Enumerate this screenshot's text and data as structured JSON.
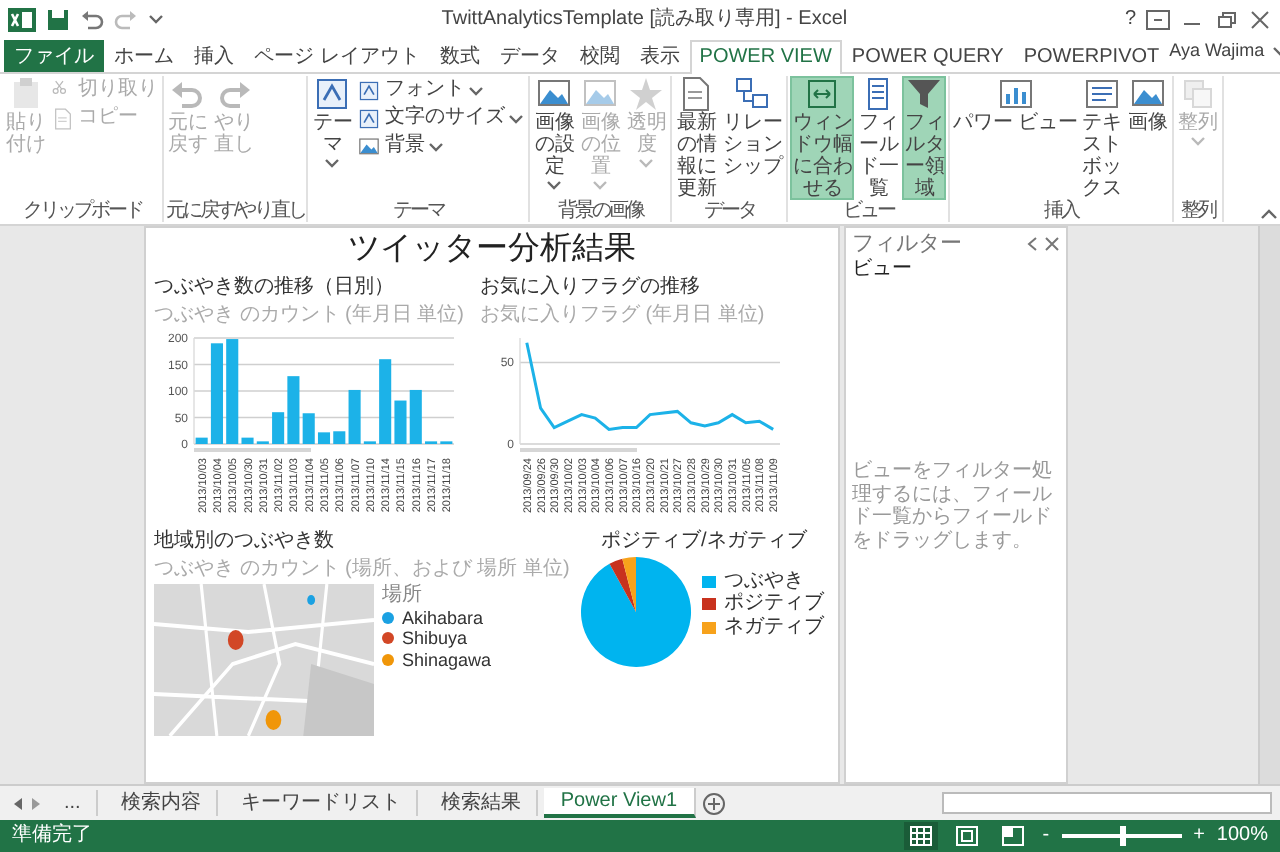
{
  "title_bar": {
    "title": "TwittAnalyticsTemplate [読み取り専用] - Excel",
    "help": "?"
  },
  "tabs": [
    {
      "label": "ファイル",
      "kind": "file",
      "selected": false
    },
    {
      "label": "ホーム",
      "kind": "tab",
      "selected": false
    },
    {
      "label": "挿入",
      "kind": "tab",
      "selected": false
    },
    {
      "label": "ページ レイアウト",
      "kind": "tab",
      "selected": false
    },
    {
      "label": "数式",
      "kind": "tab",
      "selected": false
    },
    {
      "label": "データ",
      "kind": "tab",
      "selected": false
    },
    {
      "label": "校閲",
      "kind": "tab",
      "selected": false
    },
    {
      "label": "表示",
      "kind": "tab",
      "selected": false
    },
    {
      "label": "POWER VIEW",
      "kind": "tab",
      "selected": true
    },
    {
      "label": "POWER QUERY",
      "kind": "tab",
      "selected": false
    },
    {
      "label": "POWERPIVOT",
      "kind": "tab",
      "selected": false
    }
  ],
  "account": {
    "name": "Aya Wajima"
  },
  "ribbon": {
    "groups": [
      {
        "label": "クリップボード",
        "buttons": [
          {
            "label": "貼り付け",
            "kind": "large",
            "dropdown": false,
            "disabled": true,
            "on": false
          },
          {
            "label": "切り取り",
            "kind": "small",
            "dropdown": false,
            "disabled": true,
            "on": false
          },
          {
            "label": "コピー",
            "kind": "small",
            "dropdown": false,
            "disabled": true,
            "on": false
          }
        ]
      },
      {
        "label": "元に戻す/やり直し",
        "buttons": [
          {
            "label": "元に戻す",
            "kind": "large",
            "dropdown": false,
            "disabled": true,
            "on": false
          },
          {
            "label": "やり直し",
            "kind": "large",
            "dropdown": false,
            "disabled": true,
            "on": false
          }
        ]
      },
      {
        "label": "テーマ",
        "buttons": [
          {
            "label": "テーマ",
            "kind": "large",
            "dropdown": true,
            "disabled": false,
            "on": false
          },
          {
            "label": "フォント",
            "kind": "small",
            "dropdown": true,
            "disabled": false,
            "on": false
          },
          {
            "label": "文字のサイズ",
            "kind": "small",
            "dropdown": true,
            "disabled": false,
            "on": false
          },
          {
            "label": "背景",
            "kind": "small",
            "dropdown": true,
            "disabled": false,
            "on": false
          }
        ]
      },
      {
        "label": "背景の画像",
        "buttons": [
          {
            "label": "画像の設定",
            "kind": "large",
            "dropdown": true,
            "disabled": false,
            "on": false
          },
          {
            "label": "画像の位置",
            "kind": "large",
            "dropdown": true,
            "disabled": true,
            "on": false
          },
          {
            "label": "透明度",
            "kind": "large",
            "dropdown": true,
            "disabled": true,
            "on": false
          }
        ]
      },
      {
        "label": "データ",
        "buttons": [
          {
            "label": "最新の情報に更新",
            "kind": "large",
            "dropdown": false,
            "disabled": false,
            "on": false
          },
          {
            "label": "リレーションシップ",
            "kind": "large",
            "dropdown": false,
            "disabled": false,
            "on": false
          }
        ]
      },
      {
        "label": "ビュー",
        "buttons": [
          {
            "label": "ウィンドウ幅に合わせる",
            "kind": "large",
            "dropdown": false,
            "disabled": false,
            "on": true
          },
          {
            "label": "フィールド一覧",
            "kind": "large",
            "dropdown": false,
            "disabled": false,
            "on": false
          },
          {
            "label": "フィルター領域",
            "kind": "large",
            "dropdown": false,
            "disabled": false,
            "on": true
          }
        ]
      },
      {
        "label": "挿入",
        "buttons": [
          {
            "label": "パワー ビュー",
            "kind": "large",
            "dropdown": false,
            "disabled": false,
            "on": false
          },
          {
            "label": "テキストボックス",
            "kind": "large",
            "dropdown": false,
            "disabled": false,
            "on": false
          },
          {
            "label": "画像",
            "kind": "large",
            "dropdown": false,
            "disabled": false,
            "on": false
          }
        ]
      },
      {
        "label": "整列",
        "buttons": [
          {
            "label": "整列",
            "kind": "large",
            "dropdown": true,
            "disabled": true,
            "on": false
          }
        ]
      }
    ]
  },
  "report": {
    "title": "ツイッター分析結果",
    "visuals": [
      {
        "kind": "bar",
        "title": "つぶやき数の推移（日別）",
        "subtitle": "つぶやき のカウント (年月日 単位)",
        "chart_data": {
          "type": "bar",
          "grid": true,
          "ylim": [
            0,
            200
          ],
          "yticks": [
            0,
            50,
            100,
            150,
            200
          ],
          "categories": [
            "2013/10/03",
            "2013/10/04",
            "2013/10/05",
            "2013/10/30",
            "2013/10/31",
            "2013/11/02",
            "2013/11/03",
            "2013/11/04",
            "2013/11/05",
            "2013/11/06",
            "2013/11/07",
            "2013/11/10",
            "2013/11/14",
            "2013/11/15",
            "2013/11/16",
            "2013/11/17",
            "2013/11/18"
          ],
          "series": [
            {
              "color": "#1cb2e8",
              "values": [
                12,
                190,
                198,
                12,
                5,
                60,
                128,
                58,
                22,
                24,
                102,
                5,
                160,
                82,
                102,
                5,
                5
              ]
            }
          ]
        }
      },
      {
        "kind": "line",
        "title": "お気に入りフラグの推移",
        "subtitle": "お気に入りフラグ (年月日 単位)",
        "chart_data": {
          "type": "line",
          "grid": true,
          "ylim": [
            0,
            65
          ],
          "yticks": [
            0,
            50
          ],
          "categories": [
            "2013/09/24",
            "2013/09/26",
            "2013/09/30",
            "2013/10/02",
            "2013/10/03",
            "2013/10/04",
            "2013/10/06",
            "2013/10/07",
            "2013/10/16",
            "2013/10/20",
            "2013/10/21",
            "2013/10/27",
            "2013/10/28",
            "2013/10/29",
            "2013/10/30",
            "2013/10/31",
            "2013/11/05",
            "2013/11/08",
            "2013/11/09"
          ],
          "series": [
            {
              "color": "#1cb2e8",
              "values": [
                62,
                22,
                10,
                14,
                18,
                16,
                9,
                10,
                10,
                18,
                19,
                20,
                13,
                11,
                13,
                18,
                13,
                14,
                9
              ]
            }
          ]
        }
      },
      {
        "kind": "map",
        "title": "地域別のつぶやき数",
        "subtitle": "つぶやき のカウント (場所、および 場所 単位)",
        "legend_title": "場所",
        "legend": [
          {
            "label": "Akihabara",
            "color": "#1ba1e2"
          },
          {
            "label": "Shibuya",
            "color": "#d24726"
          },
          {
            "label": "Shinagawa",
            "color": "#f09609"
          }
        ]
      },
      {
        "kind": "pie",
        "title": "ポジティブ/ネガティブ",
        "chart_data": {
          "type": "pie",
          "categories": [
            "つぶやき",
            "ポジティブ",
            "ネガティブ"
          ],
          "series": [
            {
              "values": [
                92,
                4,
                4
              ],
              "colors": [
                "#00b4ef",
                "#c8321e",
                "#f7a21b"
              ]
            }
          ]
        }
      }
    ]
  },
  "filter_pane": {
    "title": "フィルター",
    "tab": "ビュー",
    "message": "ビューをフィルター処理するには、フィールド一覧からフィールドをドラッグします。"
  },
  "sheet_tabs": {
    "more": "...",
    "tabs": [
      {
        "label": "検索内容",
        "selected": false
      },
      {
        "label": "キーワードリスト",
        "selected": false
      },
      {
        "label": "検索結果",
        "selected": false
      },
      {
        "label": "Power View1",
        "selected": true
      }
    ]
  },
  "status_bar": {
    "status": "準備完了",
    "views": [
      {
        "selected": true
      },
      {
        "selected": false
      },
      {
        "selected": false
      }
    ],
    "zoom": {
      "minus": "-",
      "plus": "+",
      "level": 0.5,
      "reading": "100%"
    }
  }
}
